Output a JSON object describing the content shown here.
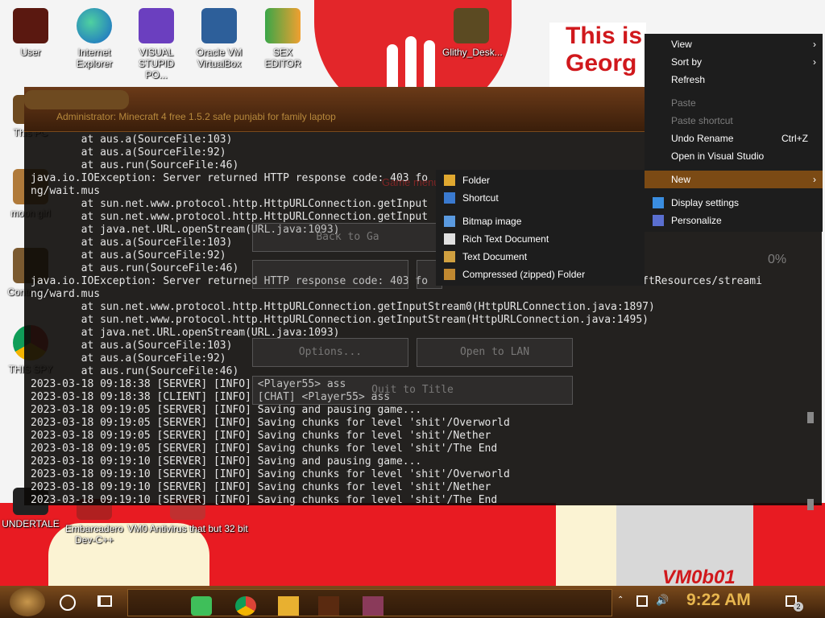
{
  "desktop_icons": [
    {
      "id": "user",
      "label": "User"
    },
    {
      "id": "edge",
      "label": "Internet Explorer"
    },
    {
      "id": "vs",
      "label": "VISUAL STUPID PO..."
    },
    {
      "id": "vbox",
      "label": "Oracle VM VirtualBox"
    },
    {
      "id": "hxd",
      "label": "SEX EDITOR"
    },
    {
      "id": "glithy",
      "label": "Glithy_Desk..."
    },
    {
      "id": "thispc",
      "label": "This PC"
    },
    {
      "id": "moongirl",
      "label": "moon girl"
    },
    {
      "id": "controlling",
      "label": "Controlling"
    },
    {
      "id": "chrome",
      "label": "THIS SPY"
    },
    {
      "id": "undertale",
      "label": "UNDERTALE"
    },
    {
      "id": "devcpp",
      "label": "Embarcadero Dev-C++"
    },
    {
      "id": "vm0",
      "label": "VM0 Antivirus that but 32 bit"
    }
  ],
  "wallpaper": {
    "banner_line1": "This is",
    "banner_line2": "Georg",
    "vm_label": "VM0b01"
  },
  "console": {
    "title": "Administrator:  Minecraft 4 free 1.5.2 safe punjabi for family laptop",
    "lines": [
      "        at aus.a(SourceFile:103)",
      "        at aus.a(SourceFile:92)",
      "        at aus.run(SourceFile:46)",
      "java.io.IOException: Server returned HTTP response code: 403 fo",
      "ng/wait.mus",
      "        at sun.net.www.protocol.http.HttpURLConnection.getInput",
      "        at sun.net.www.protocol.http.HttpURLConnection.getInput",
      "        at java.net.URL.openStream(URL.java:1093)",
      "        at aus.a(SourceFile:103)",
      "        at aus.a(SourceFile:92)",
      "        at aus.run(SourceFile:46)",
      "java.io.IOException: Server returned HTTP response code: 403 fo                            inecraftResources/streami",
      "ng/ward.mus",
      "        at sun.net.www.protocol.http.HttpURLConnection.getInputStream0(HttpURLConnection.java:1897)",
      "        at sun.net.www.protocol.http.HttpURLConnection.getInputStream(HttpURLConnection.java:1495)",
      "        at java.net.URL.openStream(URL.java:1093)",
      "        at aus.a(SourceFile:103)",
      "        at aus.a(SourceFile:92)",
      "        at aus.run(SourceFile:46)",
      "2023-03-18 09:18:38 [SERVER] [INFO] <Player55> ass",
      "2023-03-18 09:18:38 [CLIENT] [INFO] [CHAT] <Player55> ass",
      "2023-03-18 09:19:05 [SERVER] [INFO] Saving and pausing game...",
      "2023-03-18 09:19:05 [SERVER] [INFO] Saving chunks for level 'shit'/Overworld",
      "2023-03-18 09:19:05 [SERVER] [INFO] Saving chunks for level 'shit'/Nether",
      "2023-03-18 09:19:05 [SERVER] [INFO] Saving chunks for level 'shit'/The End",
      "2023-03-18 09:19:10 [SERVER] [INFO] Saving and pausing game...",
      "2023-03-18 09:19:10 [SERVER] [INFO] Saving chunks for level 'shit'/Overworld",
      "2023-03-18 09:19:10 [SERVER] [INFO] Saving chunks for level 'shit'/Nether",
      "2023-03-18 09:19:10 [SERVER] [INFO] Saving chunks for level 'shit'/The End"
    ]
  },
  "game_menu": {
    "heading": "Game menu",
    "back_to_game": "Back to Ga",
    "options": "Options...",
    "open_to_lan": "Open to LAN",
    "quit_to_title": "Quit to Title",
    "percent": "0%"
  },
  "context_menu": {
    "items": [
      {
        "label": "View",
        "submenu": true
      },
      {
        "label": "Sort by",
        "submenu": true
      },
      {
        "label": "Refresh"
      },
      {
        "label": "Paste",
        "disabled": true
      },
      {
        "label": "Paste shortcut",
        "disabled": true
      },
      {
        "label": "Undo Rename",
        "shortcut": "Ctrl+Z"
      },
      {
        "label": "Open in Visual Studio"
      },
      {
        "label": "New",
        "submenu": true,
        "selected": true
      },
      {
        "label": "Display settings"
      },
      {
        "label": "Personalize"
      }
    ]
  },
  "new_submenu": {
    "items": [
      {
        "label": "Folder"
      },
      {
        "label": "Shortcut"
      },
      {
        "label": "Bitmap image"
      },
      {
        "label": "Rich Text Document"
      },
      {
        "label": "Text Document"
      },
      {
        "label": "Compressed (zipped) Folder"
      }
    ]
  },
  "taskbar": {
    "clock": "9:22 AM",
    "notification_count": "2"
  },
  "colors": {
    "accent": "#7b4a14",
    "clock": "#e8b64e",
    "menu_bg": "#1d1d1d"
  }
}
